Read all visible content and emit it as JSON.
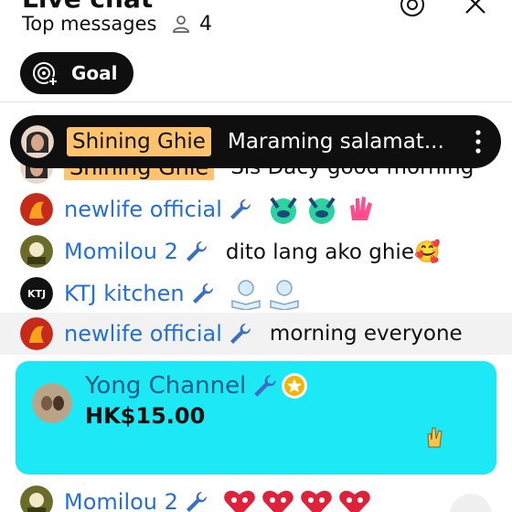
{
  "header": {
    "title": "Live chat",
    "subtitle": "Top messages",
    "viewer_count": "4",
    "goal_label": "Goal"
  },
  "pinned": {
    "author": "Shining Ghie",
    "message": "Maraming salamat..."
  },
  "messages": [
    {
      "author": "Shining Ghie",
      "text": "Sis Dacy good morning",
      "moderator": false
    },
    {
      "author": "newlife official",
      "text": "",
      "moderator": true,
      "emojis": [
        "hands-raised-emoji",
        "hands-raised-emoji",
        "waving-hand-emoji"
      ]
    },
    {
      "author": "Momilou 2",
      "text": "dito lang ako ghie🥰",
      "moderator": true
    },
    {
      "author": "KTJ kitchen",
      "text": "",
      "moderator": true,
      "emojis": [
        "lightbulb-book-emoji",
        "lightbulb-book-emoji"
      ]
    },
    {
      "author": "newlife official",
      "text": "morning everyone",
      "moderator": true
    }
  ],
  "superchat": {
    "author": "Yong Channel",
    "amount": "HK$15.00",
    "color": "#1de9f6"
  },
  "last_message": {
    "author": "Momilou 2",
    "emojis": [
      "red-heart-face-emoji",
      "red-heart-face-emoji",
      "red-heart-face-emoji",
      "red-heart-face-emoji"
    ]
  },
  "colors": {
    "author": "#2470d6",
    "pinned_badge": "#ffc36e",
    "moderator_wrench": "#3b6fc4"
  }
}
